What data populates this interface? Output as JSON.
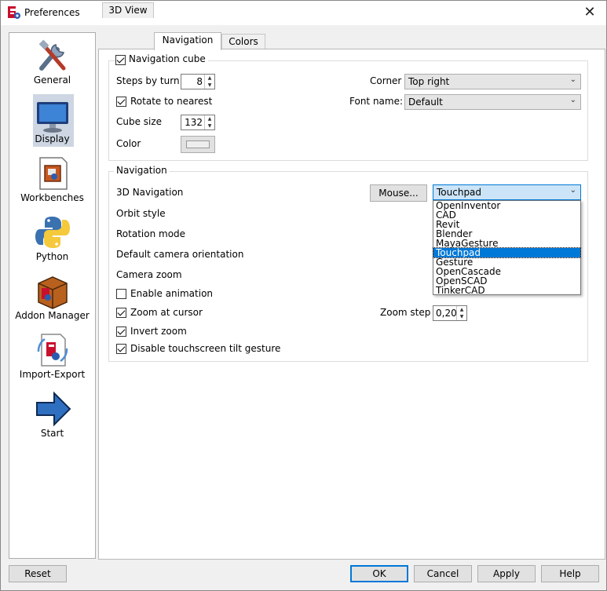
{
  "window": {
    "title": "Preferences",
    "close_glyph": "✕"
  },
  "sidebar": {
    "items": [
      {
        "label": "General",
        "icon": "tools-icon"
      },
      {
        "label": "Display",
        "icon": "monitor-icon",
        "selected": true
      },
      {
        "label": "Workbenches",
        "icon": "workbench-icon"
      },
      {
        "label": "Python",
        "icon": "python-icon"
      },
      {
        "label": "Addon Manager",
        "icon": "addon-box-icon"
      },
      {
        "label": "Import-Export",
        "icon": "import-export-icon"
      },
      {
        "label": "Start",
        "icon": "arrow-right-icon"
      }
    ]
  },
  "tabs": [
    {
      "label": "3D View"
    },
    {
      "label": "Navigation",
      "active": true
    },
    {
      "label": "Colors"
    }
  ],
  "nav_cube": {
    "title": "Navigation cube",
    "enabled": true,
    "steps_label": "Steps by turn",
    "steps_value": "8",
    "rotate_label": "Rotate to nearest",
    "rotate_checked": true,
    "cube_size_label": "Cube size",
    "cube_size_value": "132",
    "color_label": "Color",
    "corner_label": "Corner",
    "corner_value": "Top right",
    "font_label": "Font name:",
    "font_value": "Default"
  },
  "navigation": {
    "title": "Navigation",
    "nav3d_label": "3D Navigation",
    "mouse_button": "Mouse...",
    "nav3d_value": "Touchpad",
    "orbit_label": "Orbit style",
    "rotation_label": "Rotation mode",
    "camera_orient_label": "Default camera orientation",
    "camera_zoom_label": "Camera zoom",
    "enable_animation_label": "Enable animation",
    "enable_animation_checked": false,
    "zoom_cursor_label": "Zoom at cursor",
    "zoom_cursor_checked": true,
    "zoom_step_label": "Zoom step",
    "zoom_step_value": "0,20",
    "invert_zoom_label": "Invert zoom",
    "invert_zoom_checked": true,
    "disable_tilt_label": "Disable touchscreen tilt gesture",
    "disable_tilt_checked": true,
    "dropdown_options": [
      "OpenInventor",
      "CAD",
      "Revit",
      "Blender",
      "MayaGesture",
      "Touchpad",
      "Gesture",
      "OpenCascade",
      "OpenSCAD",
      "TinkerCAD"
    ],
    "dropdown_selected": "Touchpad"
  },
  "footer": {
    "reset": "Reset",
    "ok": "OK",
    "cancel": "Cancel",
    "apply": "Apply",
    "help": "Help"
  },
  "colors": {
    "accent": "#0078d7",
    "selection_bg": "#cdd6e2"
  }
}
